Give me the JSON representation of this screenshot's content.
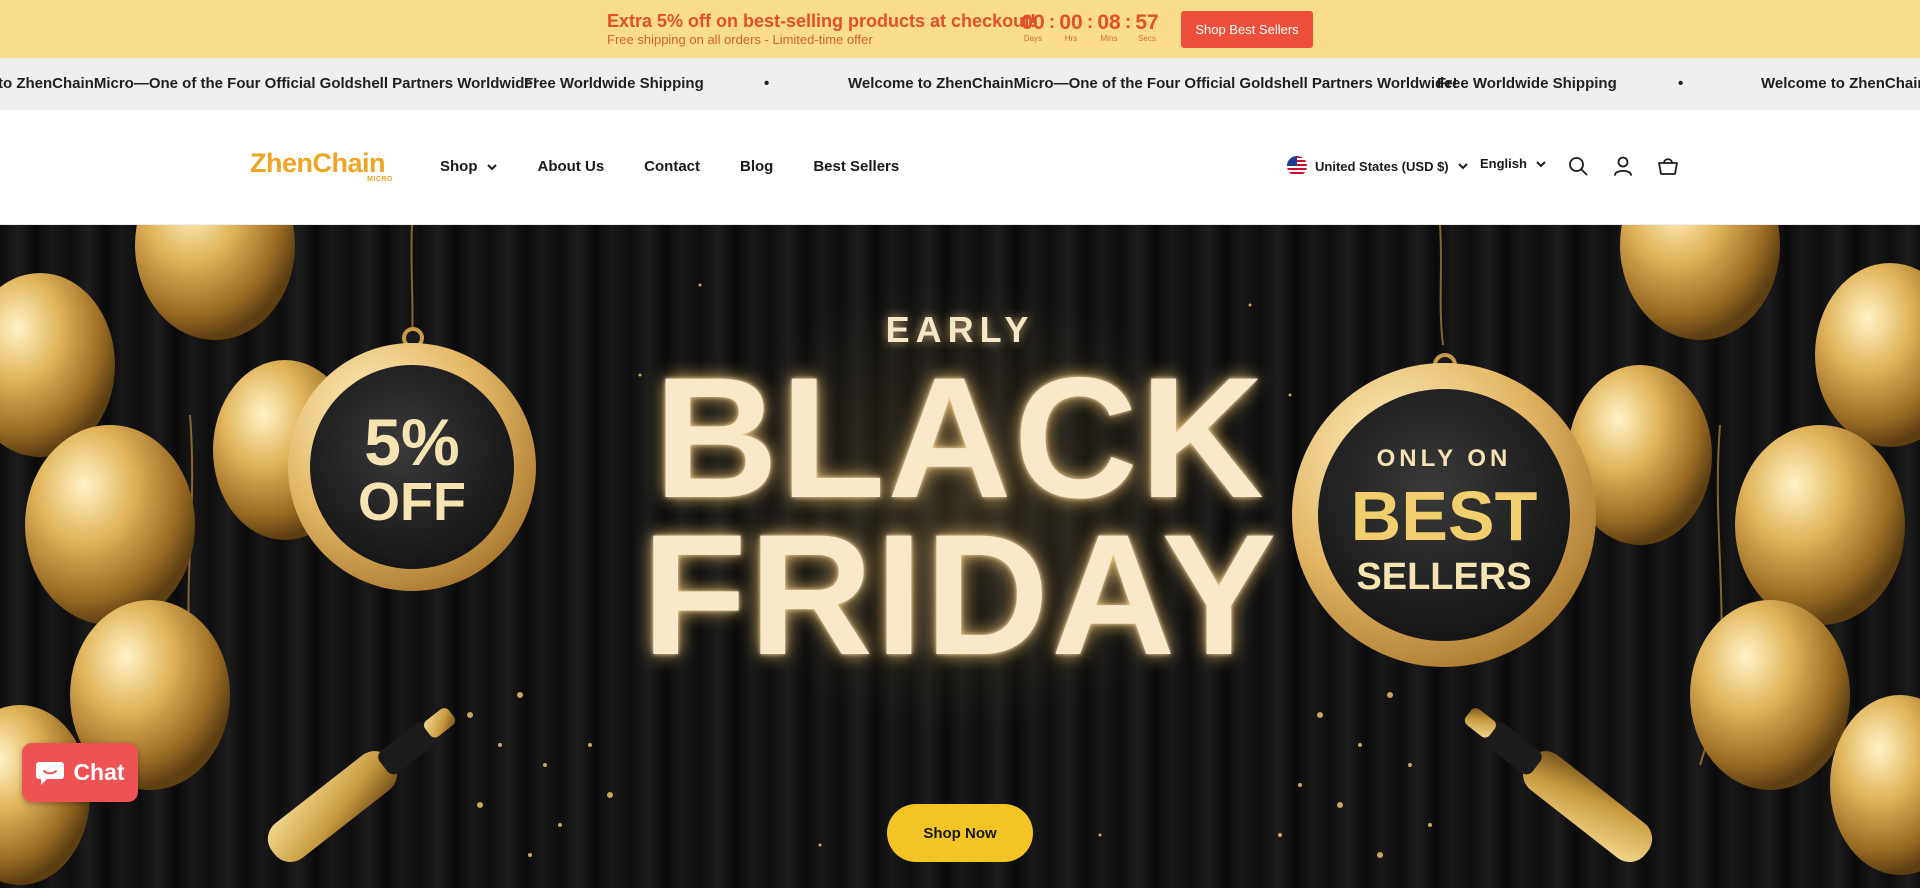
{
  "promo": {
    "title": "Extra 5% off on best-selling products at checkout!",
    "subtitle": "Free shipping on all orders - Limited-time offer",
    "countdown": [
      {
        "value": "00",
        "label": "Days"
      },
      {
        "value": "00",
        "label": "Hrs"
      },
      {
        "value": "08",
        "label": "Mins"
      },
      {
        "value": "57",
        "label": "Secs"
      }
    ],
    "separator": ":",
    "button_label": "Shop Best Sellers",
    "accent_color": "#e24f2a",
    "background_color": "#f9dd8c"
  },
  "marquee": {
    "items": [
      "to ZhenChainMicro—One of the Four Official Goldshell Partners Worldwide!",
      "Free Worldwide Shipping",
      "•",
      "Welcome to ZhenChainMicro—One of the Four Official Goldshell Partners Worldwide!",
      "Free Worldwide Shipping",
      "•",
      "Welcome to ZhenChainM"
    ]
  },
  "header": {
    "logo_text": "ZhenChain",
    "logo_sub": "MICRO",
    "nav": [
      "Shop",
      "About Us",
      "Contact",
      "Blog",
      "Best Sellers"
    ],
    "country_selector": "United States (USD $)",
    "language_selector": "English",
    "icons": [
      "search-icon",
      "account-icon",
      "cart-icon"
    ]
  },
  "hero": {
    "early": "EARLY",
    "black": "BLACK",
    "friday": "FRIDAY",
    "left_badge": {
      "line1": "5%",
      "line2": "OFF"
    },
    "right_badge": {
      "line1": "ONLY ON",
      "line2": "BEST",
      "line3": "SELLERS"
    },
    "cta_label": "Shop Now",
    "cta_color": "#f2c425"
  },
  "chat": {
    "label": "Chat",
    "color": "#ef5253"
  }
}
